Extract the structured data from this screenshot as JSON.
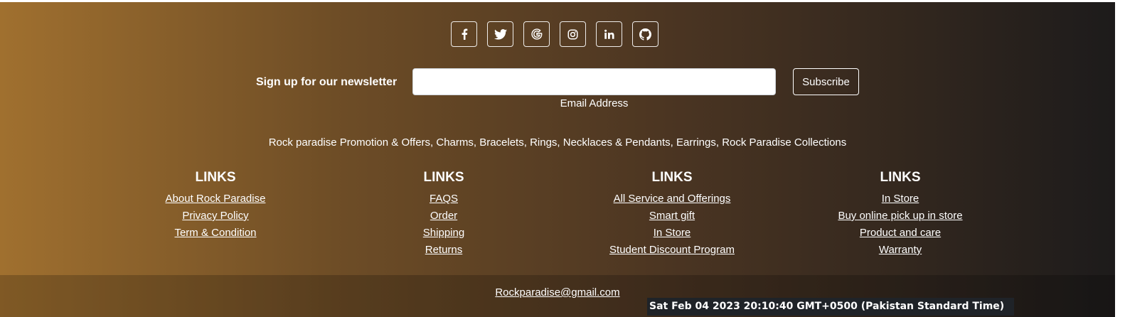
{
  "social": [
    {
      "name": "facebook-icon",
      "glyph": "f"
    },
    {
      "name": "twitter-icon",
      "glyph": "twitter"
    },
    {
      "name": "google-icon",
      "glyph": "G"
    },
    {
      "name": "instagram-icon",
      "glyph": "instagram"
    },
    {
      "name": "linkedin-icon",
      "glyph": "in"
    },
    {
      "name": "github-icon",
      "glyph": "github"
    }
  ],
  "newsletter": {
    "label": "Sign up for our newsletter",
    "input_value": "",
    "input_caption": "Email Address",
    "button": "Subscribe"
  },
  "promo": "Rock paradise Promotion & Offers, Charms, Bracelets, Rings, Necklaces & Pendants, Earrings, Rock Paradise Collections",
  "columns": [
    {
      "title": "LINKS",
      "links": [
        "About Rock Paradise",
        "Privacy Policy",
        "Term & Condition"
      ]
    },
    {
      "title": "LINKS",
      "links": [
        "FAQS",
        "Order",
        "Shipping",
        "Returns"
      ]
    },
    {
      "title": "LINKS",
      "links": [
        "All Service and Offerings",
        "Smart gift",
        "In Store",
        "Student Discount Program"
      ]
    },
    {
      "title": "LINKS",
      "links": [
        "In Store",
        "Buy online pick up in store",
        "Product and care",
        "Warranty"
      ]
    }
  ],
  "contact_email": "Rockparadise@gmail.com",
  "datetime": "Sat Feb 04 2023 20:10:40 GMT+0500 (Pakistan Standard Time)",
  "colors": {
    "gradient_start": "#a0702f",
    "gradient_end": "#1d1b1b"
  }
}
